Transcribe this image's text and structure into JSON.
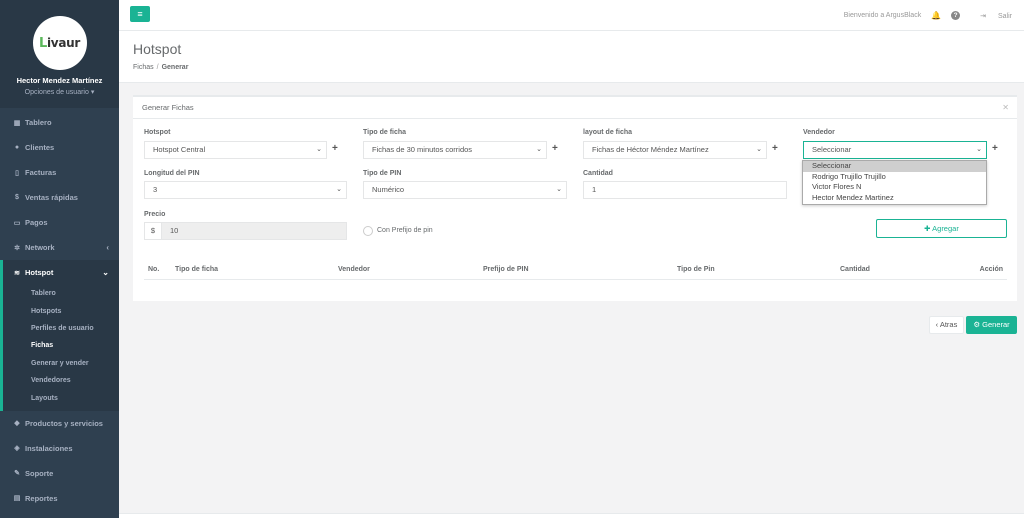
{
  "sidebar": {
    "logo_letter": "L",
    "logo_rest": "ivaur",
    "user_name": "Hector Mendez Martínez",
    "user_options": "Opciones de usuario",
    "items": [
      {
        "label": "Tablero",
        "icon": "dashboard-icon"
      },
      {
        "label": "Clientes",
        "icon": "users-icon"
      },
      {
        "label": "Facturas",
        "icon": "file-icon"
      },
      {
        "label": "Ventas rápidas",
        "icon": "dollar-icon"
      },
      {
        "label": "Pagos",
        "icon": "money-icon"
      },
      {
        "label": "Network",
        "icon": "sitemap-icon"
      }
    ],
    "hotspot": {
      "label": "Hotspot",
      "icon": "wifi-icon",
      "subitems": [
        "Tablero",
        "Hotspots",
        "Perfiles de usuario",
        "Fichas",
        "Generar y vender",
        "Vendedores",
        "Layouts"
      ],
      "active": "Fichas"
    },
    "items_bottom": [
      {
        "label": "Productos y servicios",
        "icon": "tag-icon"
      },
      {
        "label": "Instalaciones",
        "icon": "wrench-icon"
      },
      {
        "label": "Soporte",
        "icon": "support-icon"
      },
      {
        "label": "Reportes",
        "icon": "report-icon"
      }
    ]
  },
  "topbar": {
    "welcome": "Bienvenido a ArgusBlack",
    "logout": "Salir"
  },
  "heading": {
    "title": "Hotspot",
    "crumb_1": "Fichas",
    "crumb_2": "Generar"
  },
  "panel": {
    "title": "Generar Fichas",
    "hotspot_label": "Hotspot",
    "hotspot_value": "Hotspot Central",
    "tipo_ficha_label": "Tipo de ficha",
    "tipo_ficha_value": "Fichas de 30 minutos corridos",
    "layout_label": "layout de ficha",
    "layout_value": "Fichas de Héctor Méndez Martínez",
    "vendedor_label": "Vendedor",
    "vendedor_value": "Seleccionar",
    "vendedor_options": [
      "Seleccionar",
      "Rodrigo Trujillo Trujillo",
      "Victor Flores N",
      "Hector Mendez Martinez"
    ],
    "longitud_label": "Longitud del PIN",
    "longitud_value": "3",
    "tipo_pin_label": "Tipo de PIN",
    "tipo_pin_value": "Numérico",
    "cantidad_label": "Cantidad",
    "cantidad_value": "1",
    "precio_label": "Precio",
    "precio_currency": "$",
    "precio_value": "10",
    "prefijo_label": "Con Prefijo de pin",
    "agregar_label": "Agregar",
    "table_headers": [
      "No.",
      "Tipo de ficha",
      "Vendedor",
      "Prefijo de PIN",
      "Tipo de Pin",
      "Cantidad",
      "Acción"
    ]
  },
  "actions": {
    "atras": "Atras",
    "generar": "Generar"
  },
  "colors": {
    "accent": "#1ab394",
    "sidebar": "#2f4050"
  }
}
